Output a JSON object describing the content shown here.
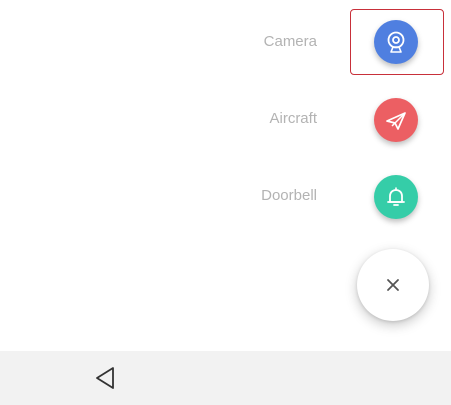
{
  "speed_dial": {
    "items": [
      {
        "label": "Camera",
        "icon": "webcam-icon",
        "color": "#4f7fe0"
      },
      {
        "label": "Aircraft",
        "icon": "paper-plane-icon",
        "color": "#ec5f63"
      },
      {
        "label": "Doorbell",
        "icon": "bell-icon",
        "color": "#35cda8"
      }
    ],
    "close_icon": "close-icon",
    "highlight_color": "#c8303a"
  },
  "navigation_bar": {
    "back_icon": "back-triangle-icon"
  }
}
